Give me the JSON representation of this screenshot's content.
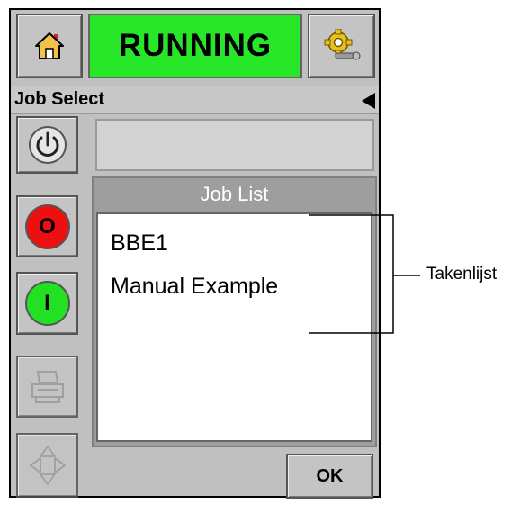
{
  "header": {
    "status_text": "RUNNING",
    "status_color": "#28e628"
  },
  "title_bar": {
    "title": "Job Select"
  },
  "job_list": {
    "title": "Job List",
    "items": [
      "BBE1",
      "Manual Example"
    ]
  },
  "footer": {
    "ok_label": "OK"
  },
  "callout": {
    "label": "Takenlijst"
  },
  "icons": {
    "home": "home-icon",
    "settings": "settings-gear-icon",
    "power": "power-icon",
    "stop": "stop-icon",
    "start": "start-icon",
    "print": "printer-icon",
    "nav": "navigation-arrows-icon"
  },
  "buttons": {
    "stop_glyph": "O",
    "start_glyph": "I"
  }
}
